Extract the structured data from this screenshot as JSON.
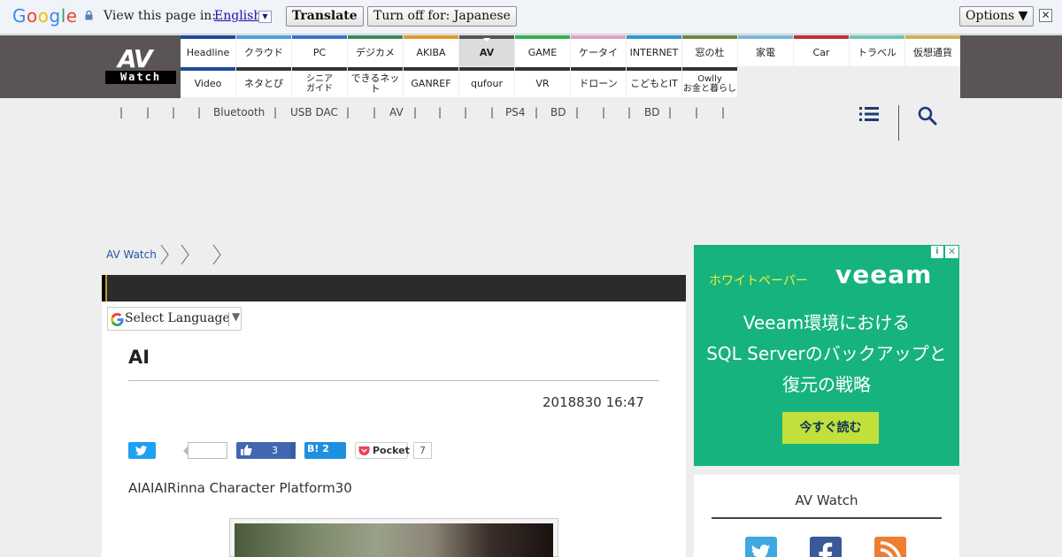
{
  "translate_bar": {
    "view_text": "View this page in:",
    "language": "English",
    "translate_label": "Translate",
    "turn_off_label": "Turn off for: Japanese",
    "options_label": "Options ▼",
    "close_glyph": "✕"
  },
  "logo": {
    "top": "AV",
    "bottom": "Watch"
  },
  "nav_row1": [
    {
      "label": "Headline",
      "color": "#1e4a9a"
    },
    {
      "label": "クラウド",
      "color": "#4aa3d8"
    },
    {
      "label": "PC",
      "color": "#3a6fd0"
    },
    {
      "label": "デジカメ",
      "color": "#3a8a5a"
    },
    {
      "label": "AKIBA",
      "color": "#e09a2a"
    },
    {
      "label": "AV",
      "color": "#555555",
      "active": true
    },
    {
      "label": "GAME",
      "color": "#2db34a"
    },
    {
      "label": "ケータイ",
      "color": "#e0a0c8"
    },
    {
      "label": "INTERNET",
      "color": "#2a9ad0"
    },
    {
      "label": "窓の杜",
      "color": "#6a8a3a"
    },
    {
      "label": "家電",
      "color": "#7ab8d8"
    },
    {
      "label": "Car",
      "color": "#c0303a"
    },
    {
      "label": "トラベル",
      "color": "#6ac8b0"
    },
    {
      "label": "仮想通貨",
      "color": "#d0b050"
    }
  ],
  "nav_row2": [
    {
      "label": "Video",
      "color": "#1e4a9a"
    },
    {
      "label": "ネタとぴ",
      "color": "#333333"
    },
    {
      "label": "シニア\nガイド",
      "color": "#333333"
    },
    {
      "label": "できるネット",
      "color": "#333333"
    },
    {
      "label": "GANREF",
      "color": "#333333"
    },
    {
      "label": "qufour",
      "color": "#333333"
    },
    {
      "label": "VR",
      "color": "#333333"
    },
    {
      "label": "ドローン",
      "color": "#333333"
    },
    {
      "label": "こどもとIT",
      "color": "#333333"
    },
    {
      "label": "Owlly\nお金と暮らし",
      "color": "#333333"
    }
  ],
  "subnav": [
    "|",
    "|",
    "|",
    "|",
    "Bluetooth",
    "|",
    "USB DAC",
    "|",
    "|",
    "AV",
    "|",
    "|",
    "|",
    "|",
    "PS4",
    "|",
    "BD",
    "|",
    "|",
    "|",
    "BD",
    "|",
    "|",
    "|"
  ],
  "breadcrumb": {
    "home": "AV Watch"
  },
  "translate_widget": {
    "label": "Select Language",
    "arrow": "▼"
  },
  "article": {
    "title": "AI",
    "date": "2018830 16:47",
    "lead": "AIAIAIRinna Character Platform30",
    "share": {
      "facebook_count": "3",
      "hatena_label": "B! 2",
      "pocket_label": "Pocket",
      "pocket_count": "7"
    }
  },
  "ad": {
    "label": "ホワイトペーパー",
    "brand": "veeam",
    "lines": [
      "Veeam環境における",
      "SQL Serverのバックアップと",
      "復元の戦略"
    ],
    "cta": "今すぐ読む",
    "info_glyph": "i",
    "close_glyph": "✕"
  },
  "follow": {
    "title": "AV Watch"
  },
  "colors": {
    "header_bg": "#5a5454",
    "ad_bg": "#16b37e",
    "link": "#2255aa"
  }
}
